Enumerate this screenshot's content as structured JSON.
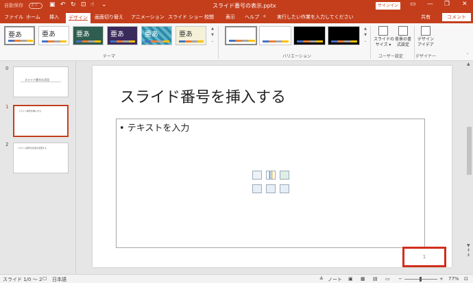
{
  "titlebar": {
    "autosave_label": "自動保存",
    "autosave_state": "オフ",
    "filename": "スライド番号の表示.pptx",
    "signin_label": "サインイン"
  },
  "tabs": {
    "items": [
      "ファイル",
      "ホーム",
      "挿入",
      "デザイン",
      "画面切り替え",
      "アニメーション",
      "スライド ショー",
      "校閲",
      "表示",
      "ヘルプ"
    ],
    "tell_me": "実行したい作業を入力してください",
    "share": "共有",
    "comment": "コメント"
  },
  "ribbon": {
    "theme_sample": "亜あ",
    "themes_group": "テーマ",
    "variants_group": "バリエーション",
    "slide_size_label": "スライドの\nサイズ ▾",
    "format_bg_label": "背景の書\n式設定",
    "user_settings_group": "ユーザー設定",
    "design_ideas_label": "デザイン\nアイデア",
    "designer_group": "デザイナー"
  },
  "slides": [
    {
      "number": "0",
      "title": "スライド番号の活用"
    },
    {
      "number": "1",
      "title": "スライド番号を挿入する"
    },
    {
      "number": "2",
      "title": "スライド番号の位置を変更する"
    }
  ],
  "slide": {
    "title": "スライド番号を挿入する",
    "bullet": "• テキストを入力",
    "slide_number": "1"
  },
  "status": {
    "slide_pos": "スライド 1/0 ～ 2",
    "language": "日本語",
    "notes": "ノート",
    "zoom": "77%"
  },
  "colors": {
    "accent": "#c43e1c",
    "highlight_box": "#d12d1b"
  }
}
